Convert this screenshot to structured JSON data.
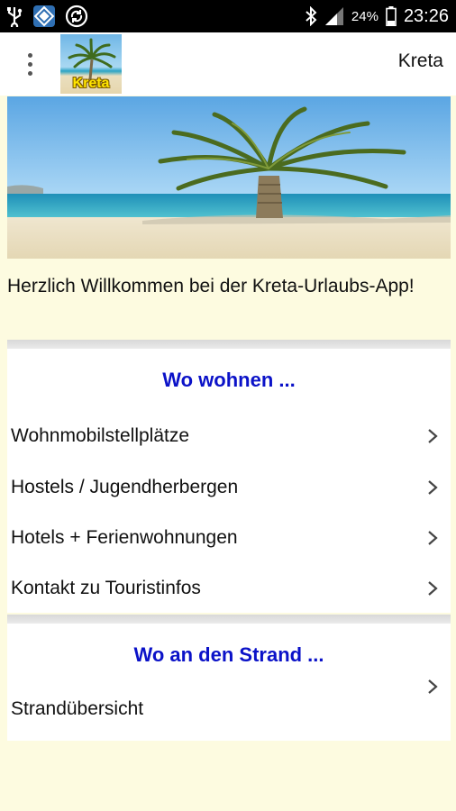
{
  "status_bar": {
    "battery_percent": "24%",
    "time": "23:26"
  },
  "app_bar": {
    "logo_text": "Kreta",
    "title": "Kreta"
  },
  "welcome_text": "Herzlich Willkommen bei der Kreta-Urlaubs-App!",
  "sections": [
    {
      "title": "Wo wohnen ...",
      "items": [
        {
          "label": "Wohnmobilstellplätze"
        },
        {
          "label": "Hostels / Jugendherbergen"
        },
        {
          "label": "Hotels + Ferienwohnungen"
        },
        {
          "label": "Kontakt zu Touristinfos"
        }
      ]
    },
    {
      "title": "Wo an den Strand ...",
      "items": [
        {
          "label": "Strandübersicht"
        }
      ]
    }
  ],
  "colors": {
    "background": "#fdfbe0",
    "section_title": "#0b12c8",
    "logo_text": "#ffe400"
  }
}
